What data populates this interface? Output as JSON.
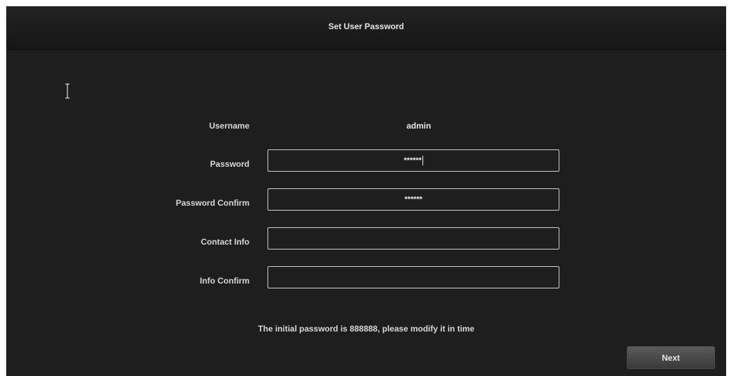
{
  "window": {
    "title": "Set User Password"
  },
  "form": {
    "username": {
      "label": "Username",
      "value": "admin"
    },
    "password": {
      "label": "Password",
      "value": "******"
    },
    "password_confirm": {
      "label": "Password Confirm",
      "value": "******"
    },
    "contact_info": {
      "label": "Contact Info",
      "value": ""
    },
    "info_confirm": {
      "label": "Info Confirm",
      "value": ""
    }
  },
  "notice": "The initial password is 888888, please modify it in time",
  "buttons": {
    "next": "Next"
  },
  "icons": {
    "text_cursor": "text-cursor-icon"
  }
}
